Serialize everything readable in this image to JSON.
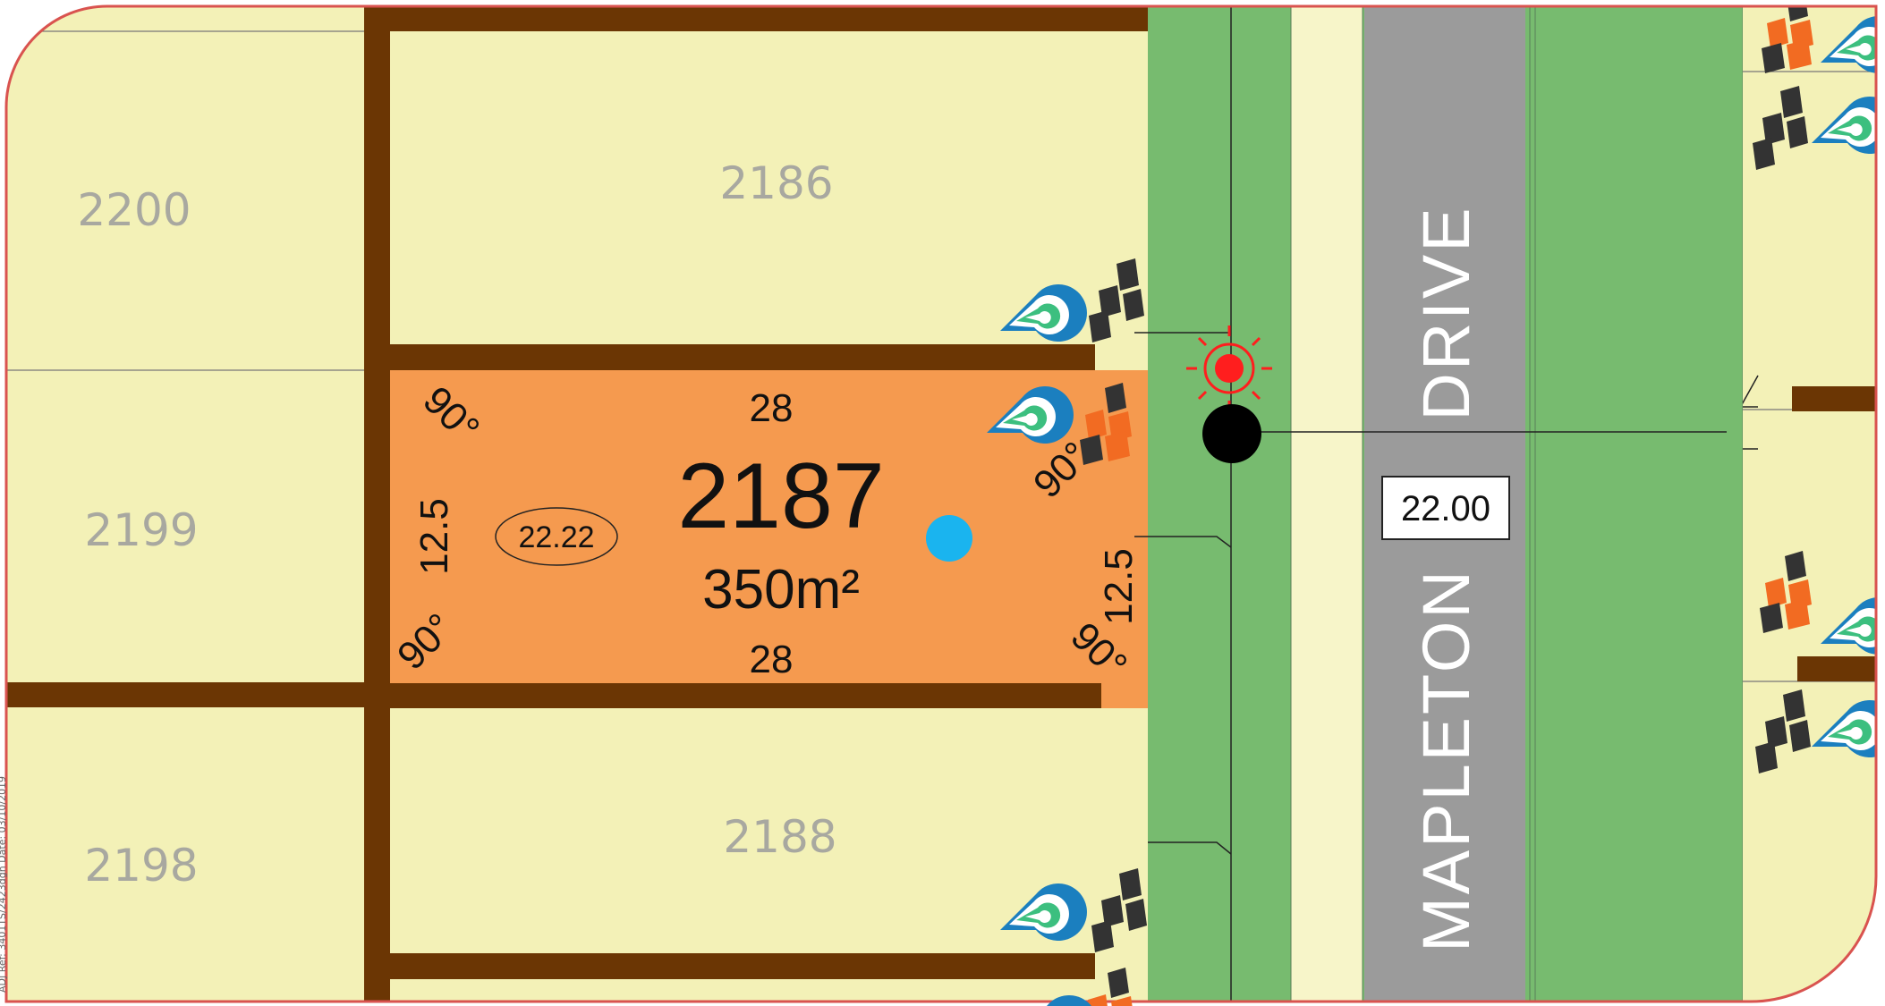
{
  "colors": {
    "lot_fill": "#f3f1b7",
    "lot_outline": "#d9534f",
    "selected_lot": "#f59a4f",
    "fence": "#6b3604",
    "verge": "#77bb6f",
    "footpath": "#f7f5c9",
    "road": "#9b9b9b",
    "marker_red": "#ff1e1e",
    "marker_blue": "#1ab4ef",
    "marker_black": "#000000",
    "brand_orange": "#f26b22",
    "brand_dark": "#333333",
    "brand_blue": "#1b7fbf",
    "brand_green": "#3cbf7f"
  },
  "lots": [
    {
      "id": "lot-2200",
      "label": "2200"
    },
    {
      "id": "lot-2186",
      "label": "2186"
    },
    {
      "id": "lot-2199",
      "label": "2199"
    },
    {
      "id": "lot-2188",
      "label": "2188"
    },
    {
      "id": "lot-2198",
      "label": "2198"
    }
  ],
  "selected_lot": {
    "number": "2187",
    "area": "350m²",
    "frontage_top": "28",
    "frontage_bottom": "28",
    "depth_left": "12.5",
    "depth_right": "12.5",
    "angle": "90°",
    "circled_value": "22.22"
  },
  "street": {
    "name_part1": "MAPLETON",
    "name_part2": "DRIVE",
    "width_label": "22.00"
  },
  "margin_text": "ADJ Ref: 3401TS/2423dgn  Date: 03/10/2019",
  "icons": [
    "red-target-marker-icon",
    "blue-dot-marker-icon",
    "black-dot-marker-icon",
    "drop-logo-icon",
    "brand-logo-icon"
  ]
}
